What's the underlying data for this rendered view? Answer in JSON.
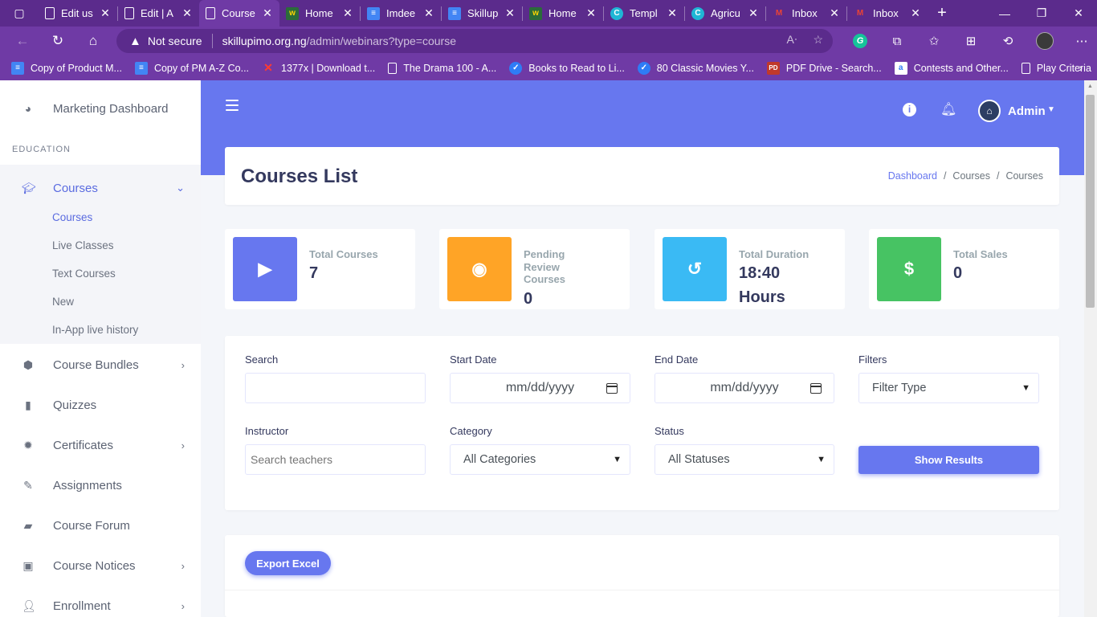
{
  "browser": {
    "tabs": [
      {
        "label": "Edit us",
        "icon": "page-icon",
        "active": false
      },
      {
        "label": "Edit | A",
        "icon": "page-icon",
        "active": false
      },
      {
        "label": "Course",
        "icon": "page-icon",
        "active": true
      },
      {
        "label": "Home",
        "icon": "site-logo-icon",
        "active": false
      },
      {
        "label": "Imdee",
        "icon": "docs-icon",
        "active": false
      },
      {
        "label": "Skillup",
        "icon": "docs-icon",
        "active": false
      },
      {
        "label": "Home",
        "icon": "site-logo-icon",
        "active": false
      },
      {
        "label": "Templ",
        "icon": "canva-icon",
        "active": false
      },
      {
        "label": "Agricu",
        "icon": "canva-icon",
        "active": false
      },
      {
        "label": "Inbox",
        "icon": "gmail-icon",
        "active": false
      },
      {
        "label": "Inbox",
        "icon": "gmail-icon",
        "active": false
      }
    ],
    "security": "Not secure",
    "url_host": "skillupimo.org.ng",
    "url_path": "/admin/webinars?type=course",
    "bookmarks": [
      {
        "label": "Copy of Product M...",
        "icon": "docs-icon"
      },
      {
        "label": "Copy of PM A-Z Co...",
        "icon": "docs-icon"
      },
      {
        "label": "1377x | Download t...",
        "icon": "x-icon"
      },
      {
        "label": "The Drama 100 - A...",
        "icon": "page-icon"
      },
      {
        "label": "Books to Read to Li...",
        "icon": "check-circle-icon"
      },
      {
        "label": "80 Classic Movies Y...",
        "icon": "check-circle-icon"
      },
      {
        "label": "PDF Drive - Search...",
        "icon": "pdf-icon"
      },
      {
        "label": "Contests and Other...",
        "icon": "a-icon"
      },
      {
        "label": "Play Criteria",
        "icon": "page-icon"
      }
    ]
  },
  "sidebar": {
    "dashboard": "Marketing Dashboard",
    "section": "EDUCATION",
    "courses": "Courses",
    "sub_items": [
      "Courses",
      "Live Classes",
      "Text Courses",
      "New",
      "In-App live history"
    ],
    "items": [
      {
        "label": "Course Bundles",
        "chevron": true
      },
      {
        "label": "Quizzes",
        "chevron": false
      },
      {
        "label": "Certificates",
        "chevron": true
      },
      {
        "label": "Assignments",
        "chevron": false
      },
      {
        "label": "Course Forum",
        "chevron": false
      },
      {
        "label": "Course Notices",
        "chevron": true
      },
      {
        "label": "Enrollment",
        "chevron": true
      }
    ]
  },
  "header": {
    "user": "Admin"
  },
  "page": {
    "title": "Courses List",
    "breadcrumb": [
      "Dashboard",
      "Courses",
      "Courses"
    ]
  },
  "stats": [
    {
      "label": "Total Courses",
      "value": "7",
      "color": "#6777ef"
    },
    {
      "label": "Pending Review Courses",
      "value": "0",
      "color": "#ffa426"
    },
    {
      "label": "Total Duration",
      "value": "18:40 Hours",
      "color": "#3abaf4"
    },
    {
      "label": "Total Sales",
      "value": "0",
      "color": "#47c363"
    }
  ],
  "filters": {
    "search_label": "Search",
    "search_value": "",
    "start_date_label": "Start Date",
    "start_date_placeholder": "mm/dd/yyyy",
    "end_date_label": "End Date",
    "end_date_placeholder": "mm/dd/yyyy",
    "filters_label": "Filters",
    "filters_value": "Filter Type",
    "instructor_label": "Instructor",
    "instructor_placeholder": "Search teachers",
    "category_label": "Category",
    "category_value": "All Categories",
    "status_label": "Status",
    "status_value": "All Statuses",
    "show_results": "Show Results"
  },
  "actions": {
    "export": "Export Excel"
  },
  "colors": {
    "primary": "#6777ef",
    "browser_frame": "#6f3aa5",
    "browser_tabbar": "#5b2b8c"
  }
}
